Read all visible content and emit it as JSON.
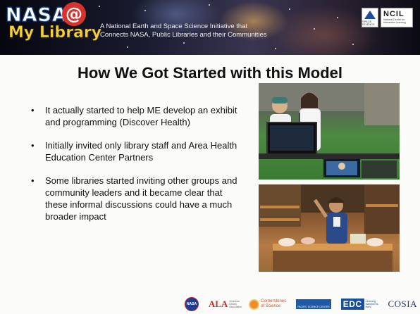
{
  "header": {
    "logo_nasa_text": "NASA",
    "logo_at_text": "@",
    "logo_library_text": "My Library",
    "tagline_line1": "A National Earth and Space Science Initiative that",
    "tagline_line2": "Connects NASA, Public Libraries and their Communities",
    "partner": {
      "space_science_label": "SPACE SCIENCE",
      "ncil_name": "NCIL",
      "ncil_subtitle": "National Center for Interactive Learning"
    }
  },
  "slide": {
    "title": "How We Got Started with this Model",
    "bullets": [
      "It actually started to help ME develop an exhibit and programming (Discover Health)",
      "Initially invited only library staff and Area Health Education Center Partners",
      "Some libraries started inviting other groups and community leaders and it became clear that these informal discussions could have a much broader impact"
    ],
    "bullet_glyph": "•"
  },
  "footer": {
    "nasa": "NASA",
    "ala": "ALA",
    "ala_sub": "American Library Association",
    "cornerstones_line1": "Cornerstones",
    "cornerstones_line2": "of Science",
    "pacific": "PACIFIC SCIENCE CENTER",
    "edc": "EDC",
    "edc_sub": "Learning transforms lives.",
    "cosia": "COSIA"
  },
  "colors": {
    "title_text": "#111111",
    "library_yellow": "#f4d23a",
    "nasa_outline": "#2756a6",
    "at_red": "#d6332c"
  }
}
